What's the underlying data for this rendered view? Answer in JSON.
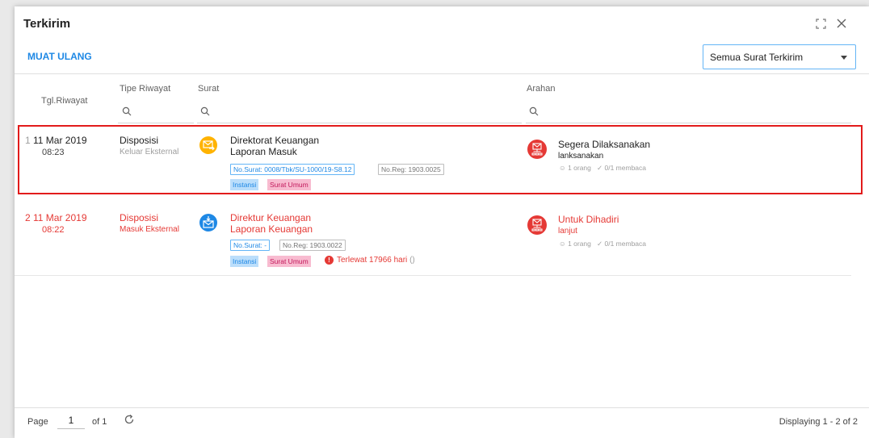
{
  "window": {
    "title": "Terkirim"
  },
  "toolbar": {
    "reload_label": "MUAT ULANG",
    "filter_value": "Semua Surat Terkirim"
  },
  "columns": {
    "tgl": "Tgl.Riwayat",
    "tipe": "Tipe Riwayat",
    "surat": "Surat",
    "arahan": "Arahan"
  },
  "rows": [
    {
      "num": "1",
      "date": "11 Mar 2019",
      "time": "08:23",
      "type": "Disposisi",
      "subtype": "Keluar Eksternal",
      "surat_line1": "Direktorat Keuangan",
      "surat_line2": "Laporan Masuk",
      "no_surat": "No.Surat: 0008/Tbk/SU-1000/19-S8.12",
      "no_reg": "No.Reg: 1903.0025",
      "tag1": "Instansi",
      "tag2": "Surat Umum",
      "arahan_line1": "Segera Dilaksanakan",
      "arahan_line2": "lanksanakan",
      "orang": "1 orang",
      "membaca": "0/1 membaca",
      "icon": "outgoing-mail-icon",
      "color": "#212121"
    },
    {
      "num": "2",
      "date": "11 Mar 2019",
      "time": "08:22",
      "type": "Disposisi",
      "subtype": "Masuk Eksternal",
      "surat_line1": "Direktur Keuangan",
      "surat_line2": "Laporan Keuangan",
      "no_surat": "No.Surat: -",
      "no_reg": "No.Reg: 1903.0022",
      "tag1": "Instansi",
      "tag2": "Surat Umum",
      "overdue": "Terlewat 17966 hari",
      "overdue_paren": "()",
      "arahan_line1": "Untuk Dihadiri",
      "arahan_line2": "lanjut",
      "orang": "1 orang",
      "membaca": "0/1 membaca",
      "icon": "incoming-mail-icon",
      "color": "#e53935"
    }
  ],
  "footer": {
    "page_label": "Page",
    "page_value": "1",
    "of_label": "of 1",
    "display": "Displaying 1 - 2 of 2"
  },
  "colors": {
    "accent": "#1e88e5",
    "overdue": "#e53935",
    "amber": "#ffb300",
    "blue_icon": "#1e88e5",
    "red_icon": "#e53935",
    "highlight": "#e21b1b"
  }
}
